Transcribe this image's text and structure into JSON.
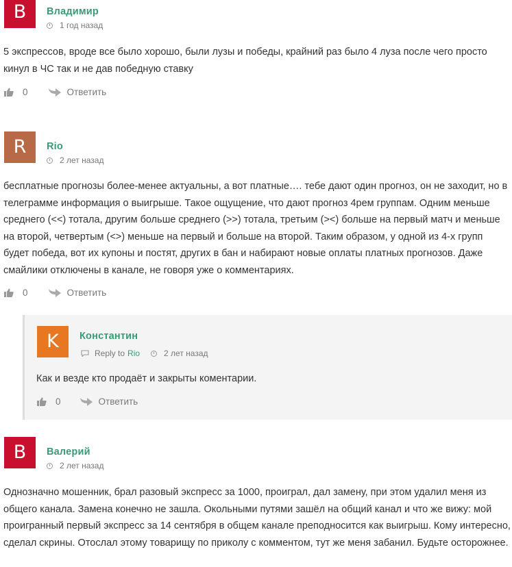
{
  "comments": [
    {
      "initial": "B",
      "color": "#c8102e",
      "author": "Владимир",
      "time": "1 год назад",
      "text": "5 экспрессов, вроде все было хорошо, были лузы и победы, крайний раз было 4 луза после чего просто кинул в ЧС так и не дав победную ставку",
      "likes": "0",
      "reply_label": "Ответить"
    },
    {
      "initial": "R",
      "color": "#b86a48",
      "author": "Rio",
      "time": "2 лет назад",
      "text": "бесплатные прогнозы более-менее актуальны, а вот платные…. тебе дают один прогноз, он не заходит, но в телеграмме информация о выигрыше. Такое ощущение, что дают прогноз 4рем группам. Одним меньше среднего (<<) тотала, другим больше среднего (>>) тотала, третьим (><) больше на первый матч и меньше на второй, четвертым (<>) меньше на первый и больше на второй. Таким образом, у одной из 4-х групп будет победа, вот их купоны и постят, других в бан и набирают новые оплаты платных прогнозов. Даже смайлики отключены в канале, не говоря уже о комментариях.",
      "likes": "0",
      "reply_label": "Ответить"
    },
    {
      "initial": "K",
      "color": "#e87722",
      "author": "Константин",
      "reply_to_label": "Reply to",
      "reply_to": "Rio",
      "time": "2 лет назад",
      "text": "Как и везде кто продаёт и закрыты коментарии.",
      "likes": "0",
      "reply_label": "Ответить"
    },
    {
      "initial": "B",
      "color": "#c8102e",
      "author": "Валерий",
      "time": "2 лет назад",
      "text": "Однозначно мошенник, брал разовый экспресс за 1000, проиграл, дал замену, при этом удалил меня из общего канала. Замена конечно не зашла. Окольными путями зашёл на общий канал и что же вижу: мой проигранный первый экспресс за 14 сентября в общем канале преподносится как выигрыш. Кому интересно, сделал скрины. Отослал этому товарищу по приколу с комментом, тут же меня забанил. Будьте осторожнее."
    }
  ],
  "icons": {
    "time": "clock-icon",
    "like": "thumbs-up-icon",
    "reply": "reply-arrow-icon",
    "reply_to": "speech-bubble-icon"
  }
}
